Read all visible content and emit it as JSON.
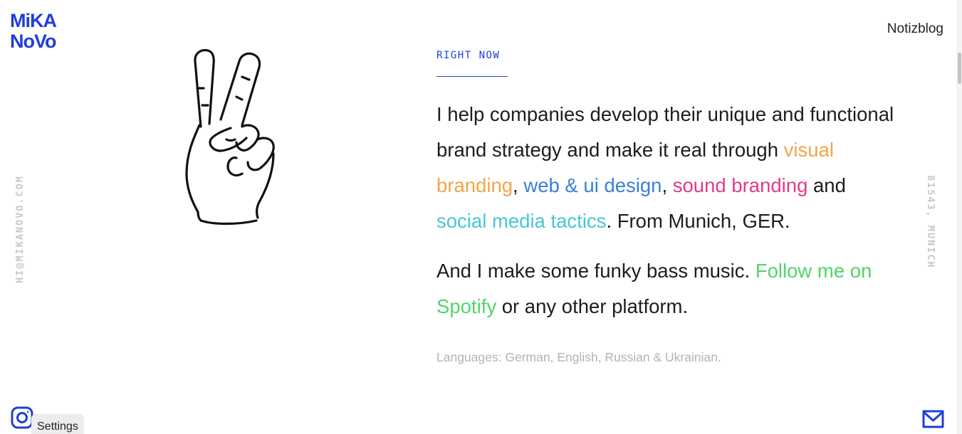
{
  "brand": {
    "logo_line1": "MiKA",
    "logo_line2": "NoVo",
    "accent_color": "#1f3fd6"
  },
  "nav": {
    "notizblog": "Notizblog"
  },
  "sidebar": {
    "left_text": "HI@MIKANOVO.COM",
    "right_text": "81543, MUNICH"
  },
  "illustration": {
    "icon": "peace-hand-icon"
  },
  "main": {
    "section_label": "RIGHT NOW",
    "intro": {
      "part1": "I help companies develop their unique and functional brand strategy and make it real through ",
      "visual_branding": "visual branding",
      "comma1": ", ",
      "web_ui_design": "web & ui design",
      "comma2": ", ",
      "sound_branding": "sound branding",
      "and": " and ",
      "social_media": "social media tactics",
      "part2": ". From Munich, GER."
    },
    "music": {
      "part1": "And I make some funky bass music. ",
      "follow_link": "Follow me on Spotify",
      "part2": " or any other platform."
    },
    "languages": "Languages: German, English, Russian & Ukrainian."
  },
  "footer": {
    "instagram_icon": "instagram-icon",
    "settings_label": "Settings",
    "mail_icon": "mail-icon"
  },
  "colors": {
    "visual_branding": "#f1a54a",
    "web_ui_design": "#3a7fd8",
    "sound_branding": "#e03b8b",
    "social_media": "#46c7d6",
    "spotify": "#52d46b",
    "muted": "#b3b3b3"
  }
}
